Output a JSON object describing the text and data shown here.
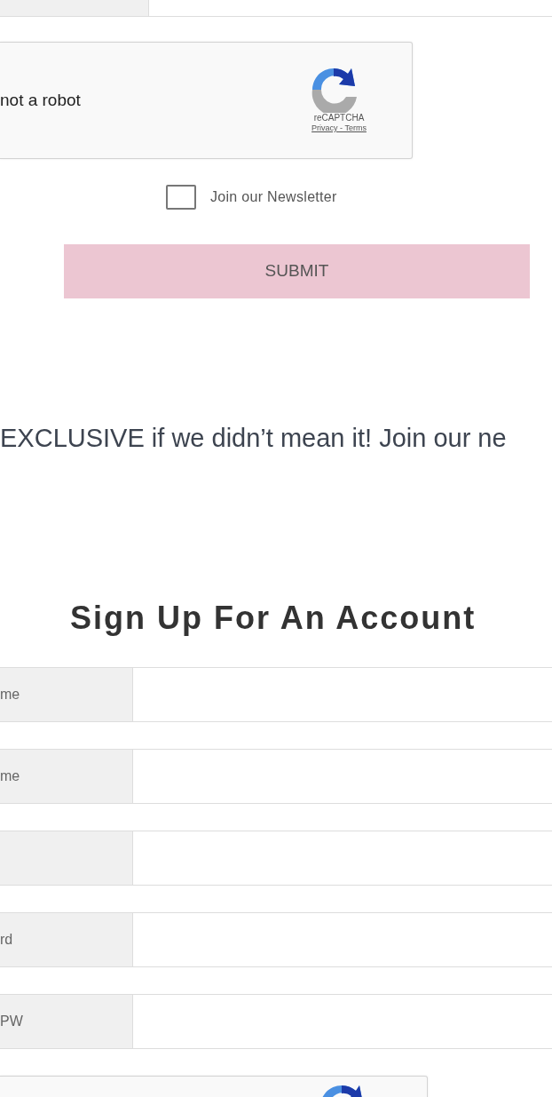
{
  "captcha": {
    "kind": "recaptcha",
    "label": "not a robot",
    "brand": "reCAPTCHA",
    "links": "Privacy - Terms"
  },
  "newsletter": {
    "label": "Join our Newsletter",
    "checked": false
  },
  "submit": {
    "label": "SUBMIT"
  },
  "promo": "EXCLUSIVE if we didn’t mean it! Join our ne",
  "signup": {
    "title": "Sign Up For An Account",
    "fields": [
      {
        "kind": "text",
        "label": "me"
      },
      {
        "kind": "text",
        "label": "me"
      },
      {
        "kind": "text"
      },
      {
        "kind": "text",
        "label": "rd"
      },
      {
        "kind": "text",
        "label": "PW"
      }
    ],
    "captcha": {
      "kind": "recaptcha"
    }
  }
}
